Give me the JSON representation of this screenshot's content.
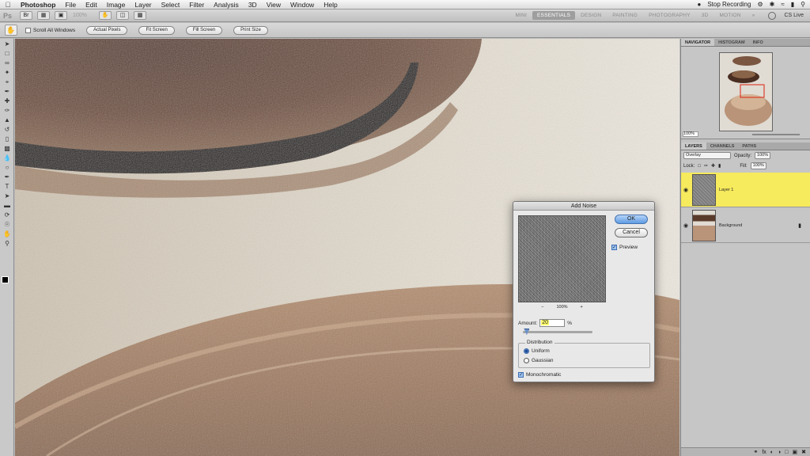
{
  "menubar": {
    "app_name": "Photoshop",
    "items": [
      "File",
      "Edit",
      "Image",
      "Layer",
      "Select",
      "Filter",
      "Analysis",
      "3D",
      "View",
      "Window",
      "Help"
    ],
    "recording": "Stop Recording"
  },
  "appbar": {
    "logo": "Ps",
    "zoom": "100%",
    "workspaces": [
      "MINI",
      "ESSENTIALS",
      "DESIGN",
      "PAINTING",
      "PHOTOGRAPHY",
      "3D",
      "MOTION"
    ],
    "active_workspace": "ESSENTIALS",
    "more": "»",
    "cs_live": "CS Live"
  },
  "optionsbar": {
    "scroll_all_windows": "Scroll All Windows",
    "buttons": [
      "Actual Pixels",
      "Fit Screen",
      "Fill Screen",
      "Print Size"
    ]
  },
  "navigator": {
    "tabs": [
      "NAVIGATOR",
      "HISTOGRAM",
      "INFO"
    ],
    "zoom": "100%"
  },
  "layers_panel": {
    "tabs": [
      "LAYERS",
      "CHANNELS",
      "PATHS"
    ],
    "blend_mode": "Overlay",
    "opacity_label": "Opacity:",
    "opacity_value": "100%",
    "lock_label": "Lock:",
    "fill_label": "Fill:",
    "fill_value": "100%",
    "layers": [
      {
        "name": "Layer 1",
        "active": true
      },
      {
        "name": "Background",
        "active": false
      }
    ]
  },
  "dialog": {
    "title": "Add Noise",
    "ok": "OK",
    "cancel": "Cancel",
    "preview_label": "Preview",
    "preview_checked": true,
    "preview_zoom": "100%",
    "zoom_out": "−",
    "zoom_in": "+",
    "amount_label": "Amount:",
    "amount_value": "20",
    "amount_unit": "%",
    "amount_fraction": 0.05,
    "distribution_label": "Distribution",
    "uniform_label": "Uniform",
    "gaussian_label": "Gaussian",
    "selected_distribution": "Uniform",
    "monochromatic_label": "Monochromatic",
    "monochromatic_checked": true
  },
  "colors": {
    "active_layer": "#f6ea5d",
    "ok_button": "#5f9be3"
  }
}
